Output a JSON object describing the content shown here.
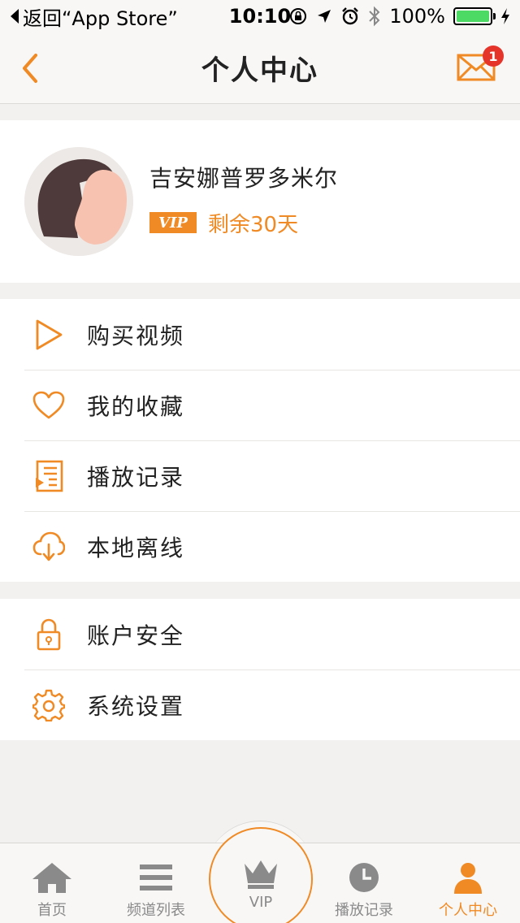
{
  "status_bar": {
    "back_text": "返回“App Store”",
    "time": "10:10",
    "battery": "100%",
    "icons": [
      "orientation-lock-icon",
      "location-arrow-icon",
      "alarm-icon",
      "bluetooth-icon",
      "battery-icon",
      "charging-icon"
    ]
  },
  "nav": {
    "title": "个人中心",
    "back_icon": "chevron-left-icon",
    "mail_icon": "mail-icon",
    "badge_count": "1"
  },
  "profile": {
    "username": "吉安娜普罗多米尔",
    "vip_badge": "VIP",
    "vip_remaining": "剩余30天"
  },
  "menu_group_1": [
    {
      "label": "购买视频",
      "icon": "play-icon"
    },
    {
      "label": "我的收藏",
      "icon": "heart-icon"
    },
    {
      "label": "播放记录",
      "icon": "playlist-icon"
    },
    {
      "label": "本地离线",
      "icon": "cloud-download-icon"
    }
  ],
  "menu_group_2": [
    {
      "label": "账户安全",
      "icon": "lock-icon"
    },
    {
      "label": "系统设置",
      "icon": "gear-icon"
    }
  ],
  "tabs": [
    {
      "label": "首页",
      "icon": "home-icon",
      "active": false
    },
    {
      "label": "频道列表",
      "icon": "list-icon",
      "active": false
    },
    {
      "label": "VIP",
      "icon": "crown-icon",
      "active": false
    },
    {
      "label": "播放记录",
      "icon": "clock-icon",
      "active": false
    },
    {
      "label": "个人中心",
      "icon": "user-icon",
      "active": true
    }
  ],
  "colors": {
    "accent": "#f08a24",
    "badge": "#e5352b",
    "battery": "#4cd964",
    "tab_inactive": "#8a8a8a"
  }
}
